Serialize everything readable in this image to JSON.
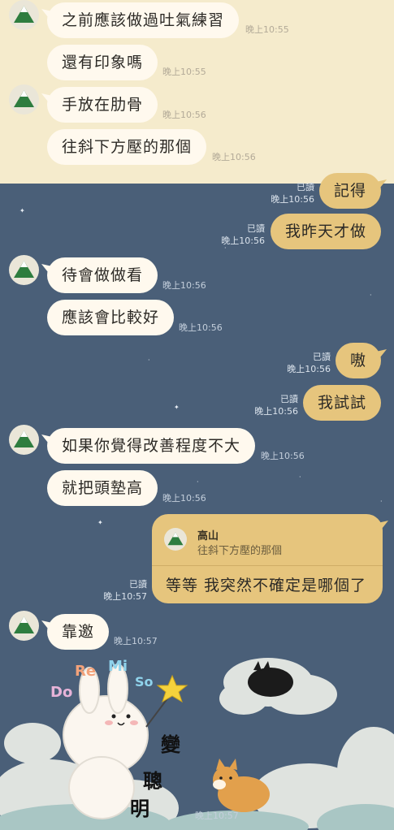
{
  "messages": [
    {
      "text": "之前應該做過吐氣練習",
      "time": "晚上10:55"
    },
    {
      "text": "還有印象嗎",
      "time": "晚上10:55"
    },
    {
      "text": "手放在肋骨",
      "time": "晚上10:56"
    },
    {
      "text": "往斜下方壓的那個",
      "time": "晚上10:56"
    },
    {
      "text": "記得",
      "read": "已讀",
      "time": "晚上10:56"
    },
    {
      "text": "我昨天才做",
      "read": "已讀",
      "time": "晚上10:56"
    },
    {
      "text": "待會做做看",
      "time": "晚上10:56"
    },
    {
      "text": "應該會比較好",
      "time": "晚上10:56"
    },
    {
      "text": "嗷",
      "read": "已讀",
      "time": "晚上10:56"
    },
    {
      "text": "我試試",
      "read": "已讀",
      "time": "晚上10:56"
    },
    {
      "text": "如果你覺得改善程度不大",
      "time": "晚上10:56"
    },
    {
      "text": "就把頭墊高",
      "time": "晚上10:56"
    },
    {
      "text": "靠邀",
      "time": "晚上10:57"
    }
  ],
  "reply": {
    "quote_name": "高山",
    "quote_text": "往斜下方壓的那個",
    "text": "等等 我突然不確定是哪個了",
    "read": "已讀",
    "time": "晚上10:57"
  },
  "sticker": {
    "letters": [
      "Do",
      "Re",
      "Mi",
      "So"
    ],
    "caption": [
      "變",
      "聰",
      "明"
    ],
    "time": "晚上10:57"
  },
  "colors": {
    "top_background": "#f5ebcc",
    "night_background": "#4a5f78",
    "incoming_bubble": "#fff9ee",
    "outgoing_bubble": "#e6c57d"
  },
  "icons": {
    "avatar": "mountain-avatar-icon"
  }
}
